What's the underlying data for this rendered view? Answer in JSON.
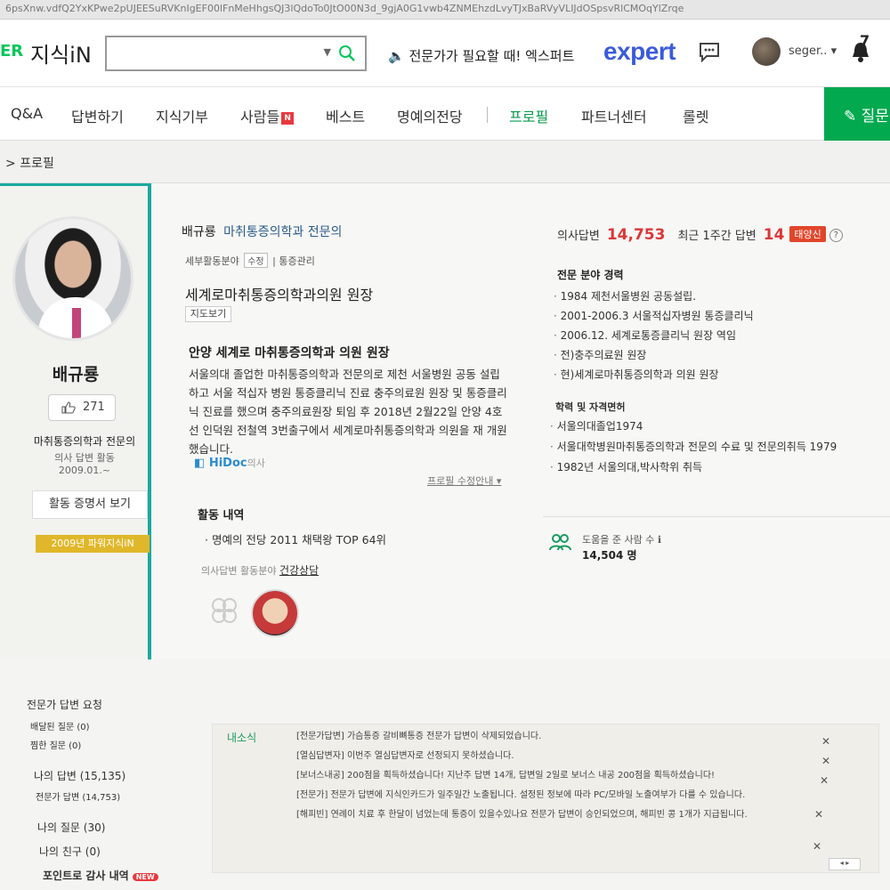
{
  "browser": {
    "url_fragment": "6psXnw.vdfQ2YxKPwe2pUJEESuRVKnIgEF00lFnMeHhgsQJ3lQdoTo0JtO00N3d_9gjA0G1vwb4ZNMEhzdLvyTJxBaRVyVLIJdOSpsvRlCMOqYlZrqe"
  },
  "header": {
    "logo_prefix": "ER",
    "logo_text": "지식iN",
    "search_placeholder": "",
    "expert_promo": "전문가가 필요할 때! 엑스퍼트",
    "expert_logo": "expert",
    "user_name": "seger..",
    "notification_count": "7"
  },
  "nav": {
    "items": [
      "Q&A",
      "답변하기",
      "지식기부",
      "사람들",
      "베스트",
      "명예의전당",
      "프로필",
      "파트너센터",
      "롤렛"
    ],
    "new_badge": "N",
    "active": "프로필",
    "ask_button": "질문"
  },
  "breadcrumb": "프로필",
  "profile": {
    "name": "배규룡",
    "likes": "271",
    "specialty": "마취통증의학과 전문의",
    "activity_label": "의사 답변 활동",
    "activity_since": "2009.01.~",
    "cert_button": "활동 증명서 보기",
    "badge": "2009년 파워지식iN"
  },
  "center": {
    "doc_name": "배규룡",
    "doc_role": "마취통증의학과 전문의",
    "subfield_label": "세부활동분야",
    "subfield_edit": "수정",
    "subfield_value": "통증관리",
    "clinic": "세계로마취통증의학과의원 원장",
    "map_button": "지도보기",
    "intro_title": "안양 세계로 마취통증의학과 의원 원장",
    "intro_text": "서울의대 졸업한 마취통증의학과 전문의로 제천 서울병원 공동 설립하고 서울 적십자 병원 통증클리닉 진료 충주의료원 원장 및 통증클리닉 진료를 했으며 충주의료원장 퇴임 후 2018년 2월22일 안양 4호선 인덕원 전철역 3번출구에서 세계로마취통증의학과 의원을 재 개원 했습니다.",
    "hidoc": "HiDoc",
    "hidoc_suffix": "의사",
    "profile_guide": "프로필 수정안내",
    "activity_title": "활동 내역",
    "activity_item": "명예의 전당 2011 채택왕 TOP 64위",
    "answer_field_label": "의사답변 활동분야",
    "answer_field_value": "건강상담"
  },
  "right": {
    "doctor_answers_label": "의사답변",
    "doctor_answers": "14,753",
    "recent_week_label": "최근 1주간 답변",
    "recent_week": "14",
    "sun_badge": "태양신",
    "career_title": "전문 분야 경력",
    "career": [
      "1984 제천서울병원 공동설립.",
      "2001-2006.3 서울적십자병원 통증클리닉",
      "2006.12. 세계로통증클리닉 원장 역임",
      "전)충주의료원 원장",
      "현)세계로마취통증의학과 의원 원장"
    ],
    "edu_title": "학력 및 자격면허",
    "education": [
      "서울의대졸업1974",
      "서울대학병원마취통증의학과 전문의 수료 및 전문의취득 1979",
      "1982년 서울의대,박사학위 취득"
    ],
    "helped_label": "도움을 준 사람 수",
    "helped_count": "14,504 명"
  },
  "sidebar": {
    "expert_request": "전문가 답변 요청",
    "assigned": "배달된 질문 (0)",
    "picked": "찜한 질문 (0)",
    "my_answers": "나의 답변 (15,135)",
    "expert_answers": "전문가 답변 (14,753)",
    "my_questions": "나의 질문 (30)",
    "my_friends": "나의 친구 (0)",
    "points": "포인트로 감사 내역",
    "new": "NEW"
  },
  "notices": {
    "title": "내소식",
    "items": [
      "[전문가답변] 가슴통증 갈비뼈통증 전문가 답변이 삭제되었습니다.",
      "[열심답변자] 이번주 열심답변자로 선정되지 못하셨습니다.",
      "[보너스내공] 200점을 획득하셨습니다! 지난주 답변 14개, 답변일 2일로 보너스 내공 200점을 획득하셨습니다!",
      "[전문가] 전문가 답변에 지식인카드가 일주일간 노출됩니다. 설정된 정보에 따라 PC/모바일 노출여부가 다를 수 있습니다.",
      "[해피빈] 연례이 치료 후 한달이 넘었는데 통증이 있을수있나요 전문가 답변이 승인되었으며, 해피빈 콩 1개가 지급됩니다."
    ]
  }
}
